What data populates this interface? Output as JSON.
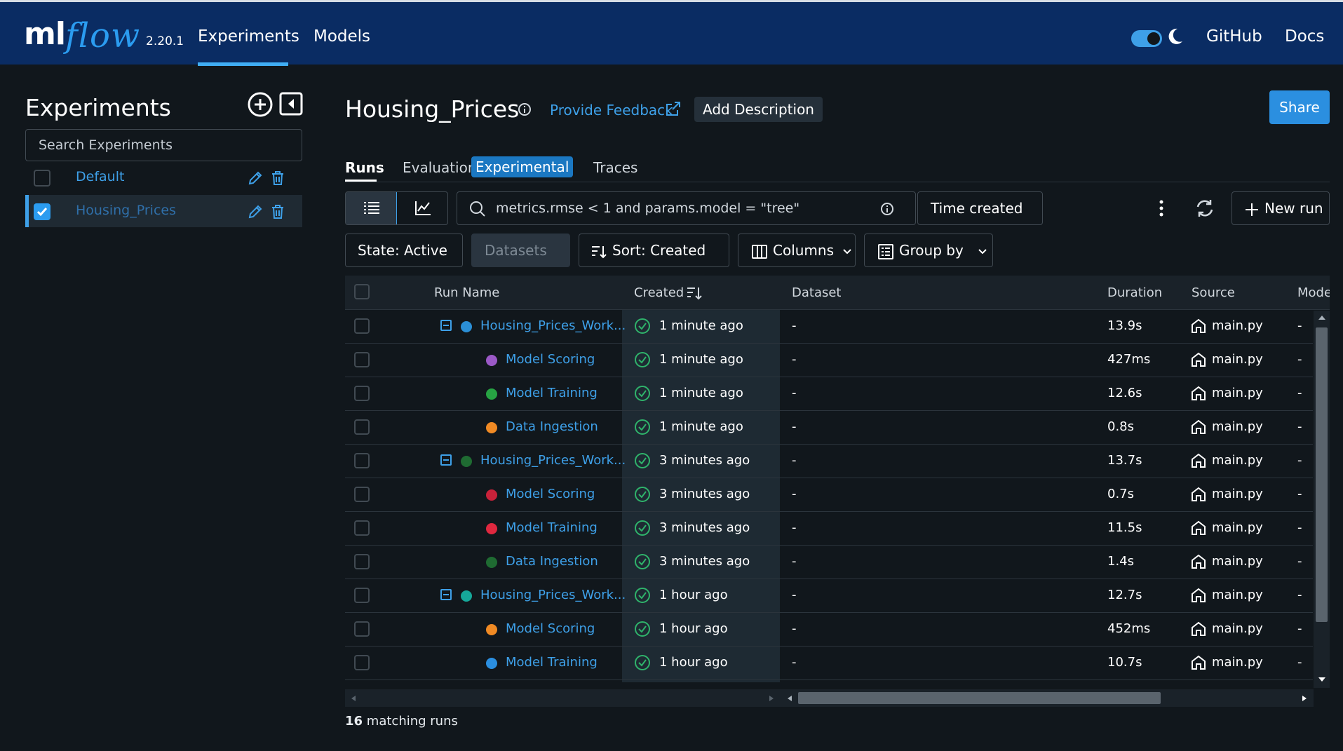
{
  "header": {
    "logo_ml": "ml",
    "logo_flow": "flow",
    "version": "2.20.1",
    "nav": [
      "Experiments",
      "Models"
    ],
    "right_links": [
      "GitHub",
      "Docs"
    ]
  },
  "sidebar": {
    "title": "Experiments",
    "search_placeholder": "Search Experiments",
    "experiments": [
      {
        "name": "Default",
        "selected": false
      },
      {
        "name": "Housing_Prices",
        "selected": true
      }
    ]
  },
  "experiment": {
    "title": "Housing_Prices",
    "feedback_label": "Provide Feedback",
    "add_description_label": "Add Description",
    "share_label": "Share"
  },
  "tabs": {
    "runs": "Runs",
    "evaluation": "Evaluation",
    "evaluation_badge": "Experimental",
    "traces": "Traces"
  },
  "toolbar": {
    "search_value": "metrics.rmse < 1 and params.model = \"tree\"",
    "time_created": "Time created",
    "new_run": "New run",
    "state": "State: Active",
    "datasets": "Datasets",
    "sort": "Sort: Created",
    "columns": "Columns",
    "group_by": "Group by"
  },
  "table": {
    "columns": [
      "Run Name",
      "Created",
      "Dataset",
      "Duration",
      "Source",
      "Mode"
    ],
    "rows": [
      {
        "name": "Housing_Prices_Work...",
        "parent": true,
        "color": "#2b8fd6",
        "created": "1 minute ago",
        "dataset": "-",
        "duration": "13.9s",
        "source": "main.py",
        "model": "-"
      },
      {
        "name": "Model Scoring",
        "parent": false,
        "color": "#9b59c7",
        "created": "1 minute ago",
        "dataset": "-",
        "duration": "427ms",
        "source": "main.py",
        "model": "-"
      },
      {
        "name": "Model Training",
        "parent": false,
        "color": "#27a343",
        "created": "1 minute ago",
        "dataset": "-",
        "duration": "12.6s",
        "source": "main.py",
        "model": "-"
      },
      {
        "name": "Data Ingestion",
        "parent": false,
        "color": "#f08a24",
        "created": "1 minute ago",
        "dataset": "-",
        "duration": "0.8s",
        "source": "main.py",
        "model": "-"
      },
      {
        "name": "Housing_Prices_Work...",
        "parent": true,
        "color": "#1f6b32",
        "created": "3 minutes ago",
        "dataset": "-",
        "duration": "13.7s",
        "source": "main.py",
        "model": "-"
      },
      {
        "name": "Model Scoring",
        "parent": false,
        "color": "#c9223a",
        "created": "3 minutes ago",
        "dataset": "-",
        "duration": "0.7s",
        "source": "main.py",
        "model": "-"
      },
      {
        "name": "Model Training",
        "parent": false,
        "color": "#e0283f",
        "created": "3 minutes ago",
        "dataset": "-",
        "duration": "11.5s",
        "source": "main.py",
        "model": "-"
      },
      {
        "name": "Data Ingestion",
        "parent": false,
        "color": "#1f6b32",
        "created": "3 minutes ago",
        "dataset": "-",
        "duration": "1.4s",
        "source": "main.py",
        "model": "-"
      },
      {
        "name": "Housing_Prices_Work...",
        "parent": true,
        "color": "#16a89a",
        "created": "1 hour ago",
        "dataset": "-",
        "duration": "12.7s",
        "source": "main.py",
        "model": "-"
      },
      {
        "name": "Model Scoring",
        "parent": false,
        "color": "#f08a24",
        "created": "1 hour ago",
        "dataset": "-",
        "duration": "452ms",
        "source": "main.py",
        "model": "-"
      },
      {
        "name": "Model Training",
        "parent": false,
        "color": "#2b8fe0",
        "created": "1 hour ago",
        "dataset": "-",
        "duration": "10.7s",
        "source": "main.py",
        "model": "-"
      }
    ]
  },
  "footer": {
    "count": "16",
    "suffix": "matching runs"
  }
}
